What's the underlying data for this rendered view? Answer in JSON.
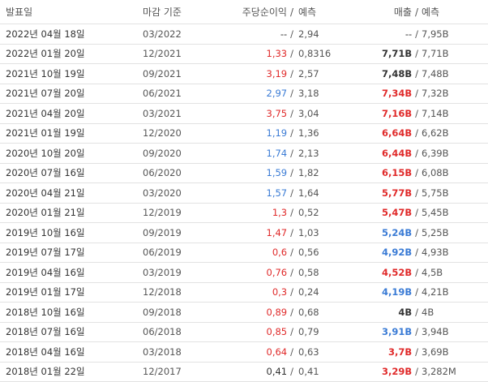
{
  "headers": {
    "date": "발표일",
    "period": "마감 기준",
    "eps": "주당순이익",
    "eps_forecast": "예측",
    "revenue": "매출",
    "revenue_forecast": "예측",
    "slash": "/"
  },
  "colors": {
    "beat": "#e02a2a",
    "miss": "#3a7bd5",
    "neutral": "#333333"
  },
  "rows": [
    {
      "date": "2022년 04월 18일",
      "period": "03/2022",
      "eps": "--",
      "eps_status": "neutral",
      "eps_forecast": "2,94",
      "revenue": "--",
      "revenue_status": "neutral",
      "revenue_forecast": "7,95B"
    },
    {
      "date": "2022년 01월 20일",
      "period": "12/2021",
      "eps": "1,33",
      "eps_status": "up",
      "eps_forecast": "0,8316",
      "revenue": "7,71B",
      "revenue_status": "neutral",
      "revenue_forecast": "7,71B"
    },
    {
      "date": "2021년 10월 19일",
      "period": "09/2021",
      "eps": "3,19",
      "eps_status": "up",
      "eps_forecast": "2,57",
      "revenue": "7,48B",
      "revenue_status": "neutral",
      "revenue_forecast": "7,48B"
    },
    {
      "date": "2021년 07월 20일",
      "period": "06/2021",
      "eps": "2,97",
      "eps_status": "down",
      "eps_forecast": "3,18",
      "revenue": "7,34B",
      "revenue_status": "up",
      "revenue_forecast": "7,32B"
    },
    {
      "date": "2021년 04월 20일",
      "period": "03/2021",
      "eps": "3,75",
      "eps_status": "up",
      "eps_forecast": "3,04",
      "revenue": "7,16B",
      "revenue_status": "up",
      "revenue_forecast": "7,14B"
    },
    {
      "date": "2021년 01월 19일",
      "period": "12/2020",
      "eps": "1,19",
      "eps_status": "down",
      "eps_forecast": "1,36",
      "revenue": "6,64B",
      "revenue_status": "up",
      "revenue_forecast": "6,62B"
    },
    {
      "date": "2020년 10월 20일",
      "period": "09/2020",
      "eps": "1,74",
      "eps_status": "down",
      "eps_forecast": "2,13",
      "revenue": "6,44B",
      "revenue_status": "up",
      "revenue_forecast": "6,39B"
    },
    {
      "date": "2020년 07월 16일",
      "period": "06/2020",
      "eps": "1,59",
      "eps_status": "down",
      "eps_forecast": "1,82",
      "revenue": "6,15B",
      "revenue_status": "up",
      "revenue_forecast": "6,08B"
    },
    {
      "date": "2020년 04월 21일",
      "period": "03/2020",
      "eps": "1,57",
      "eps_status": "down",
      "eps_forecast": "1,64",
      "revenue": "5,77B",
      "revenue_status": "up",
      "revenue_forecast": "5,75B"
    },
    {
      "date": "2020년 01월 21일",
      "period": "12/2019",
      "eps": "1,3",
      "eps_status": "up",
      "eps_forecast": "0,52",
      "revenue": "5,47B",
      "revenue_status": "up",
      "revenue_forecast": "5,45B"
    },
    {
      "date": "2019년 10월 16일",
      "period": "09/2019",
      "eps": "1,47",
      "eps_status": "up",
      "eps_forecast": "1,03",
      "revenue": "5,24B",
      "revenue_status": "down",
      "revenue_forecast": "5,25B"
    },
    {
      "date": "2019년 07월 17일",
      "period": "06/2019",
      "eps": "0,6",
      "eps_status": "up",
      "eps_forecast": "0,56",
      "revenue": "4,92B",
      "revenue_status": "down",
      "revenue_forecast": "4,93B"
    },
    {
      "date": "2019년 04월 16일",
      "period": "03/2019",
      "eps": "0,76",
      "eps_status": "up",
      "eps_forecast": "0,58",
      "revenue": "4,52B",
      "revenue_status": "up",
      "revenue_forecast": "4,5B"
    },
    {
      "date": "2019년 01월 17일",
      "period": "12/2018",
      "eps": "0,3",
      "eps_status": "up",
      "eps_forecast": "0,24",
      "revenue": "4,19B",
      "revenue_status": "down",
      "revenue_forecast": "4,21B"
    },
    {
      "date": "2018년 10월 16일",
      "period": "09/2018",
      "eps": "0,89",
      "eps_status": "up",
      "eps_forecast": "0,68",
      "revenue": "4B",
      "revenue_status": "neutral",
      "revenue_forecast": "4B"
    },
    {
      "date": "2018년 07월 16일",
      "period": "06/2018",
      "eps": "0,85",
      "eps_status": "up",
      "eps_forecast": "0,79",
      "revenue": "3,91B",
      "revenue_status": "down",
      "revenue_forecast": "3,94B"
    },
    {
      "date": "2018년 04월 16일",
      "period": "03/2018",
      "eps": "0,64",
      "eps_status": "up",
      "eps_forecast": "0,63",
      "revenue": "3,7B",
      "revenue_status": "up",
      "revenue_forecast": "3,69B"
    },
    {
      "date": "2018년 01월 22일",
      "period": "12/2017",
      "eps": "0,41",
      "eps_status": "neutral",
      "eps_forecast": "0,41",
      "revenue": "3,29B",
      "revenue_status": "up",
      "revenue_forecast": "3,282M"
    }
  ]
}
